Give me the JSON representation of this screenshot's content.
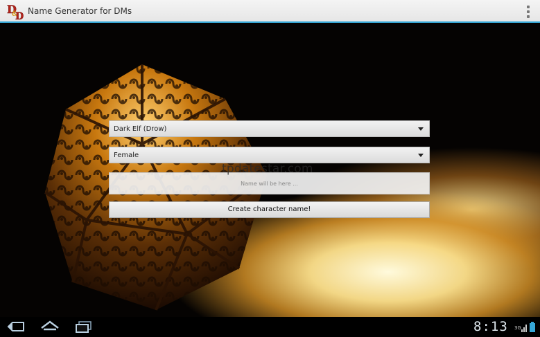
{
  "app": {
    "title": "Name Generator for DMs",
    "logo_text": "D&D",
    "accent_color": "#36a7d6"
  },
  "form": {
    "race_selected": "Dark Elf (Drow)",
    "gender_selected": "Female",
    "name_placeholder": "Name will be here ...",
    "create_label": "Create character name!"
  },
  "overlay": {
    "watermark": "tpdatestar.com"
  },
  "system_bar": {
    "clock": "8:13",
    "signal_label": "3G",
    "icons": [
      "back-icon",
      "home-icon",
      "recent-apps-icon",
      "signal-icon",
      "battery-icon"
    ]
  }
}
